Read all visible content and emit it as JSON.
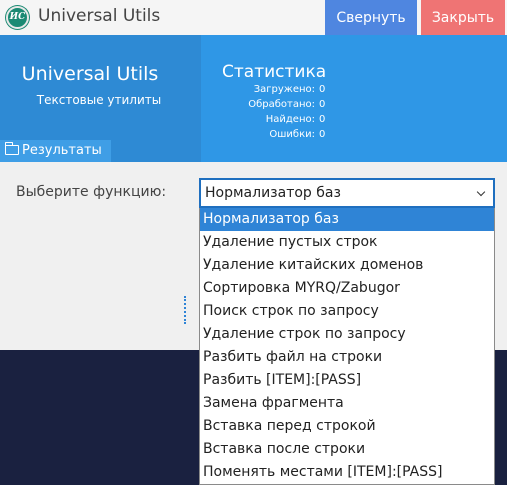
{
  "titlebar": {
    "logo_text": "ИС",
    "title": "Universal Utils",
    "collapse_label": "Свернуть",
    "close_label": "Закрыть"
  },
  "header": {
    "brand_title": "Universal Utils",
    "brand_subtitle": "Текстовые утилиты",
    "results_tab": "Результаты",
    "stats_title": "Статистика",
    "stats": [
      {
        "label": "Загружено:",
        "value": "0"
      },
      {
        "label": "Обработано:",
        "value": "0"
      },
      {
        "label": "Найдено:",
        "value": "0"
      },
      {
        "label": "Ошибки:",
        "value": "0"
      }
    ]
  },
  "main": {
    "choose_label": "Выберите функцию:",
    "selected_function": "Нормализатор баз",
    "options": [
      "Нормализатор баз",
      "Удаление пустых строк",
      "Удаление китайских доменов",
      "Сортировка MYRQ/Zabugor",
      "Поиск строк по запросу",
      "Удаление строк по запросу",
      "Разбить файл на строки",
      "Разбить [ITEM]:[PASS]",
      "Замена фрагмента",
      "Вставка перед строкой",
      "Вставка после строки",
      "Поменять местами [ITEM]:[PASS]"
    ],
    "selected_index": 0
  },
  "colors": {
    "collapse_button": "#4f86e0",
    "close_button": "#ef7474",
    "header_left": "#2e8ad4",
    "header_right": "#2f97e6",
    "selection": "#2f84d6",
    "bottom_panel": "#1a2140"
  },
  "icons": {
    "logo": "app-logo-icon",
    "results_tab": "folder-icon",
    "select": "chevron-down-icon"
  }
}
